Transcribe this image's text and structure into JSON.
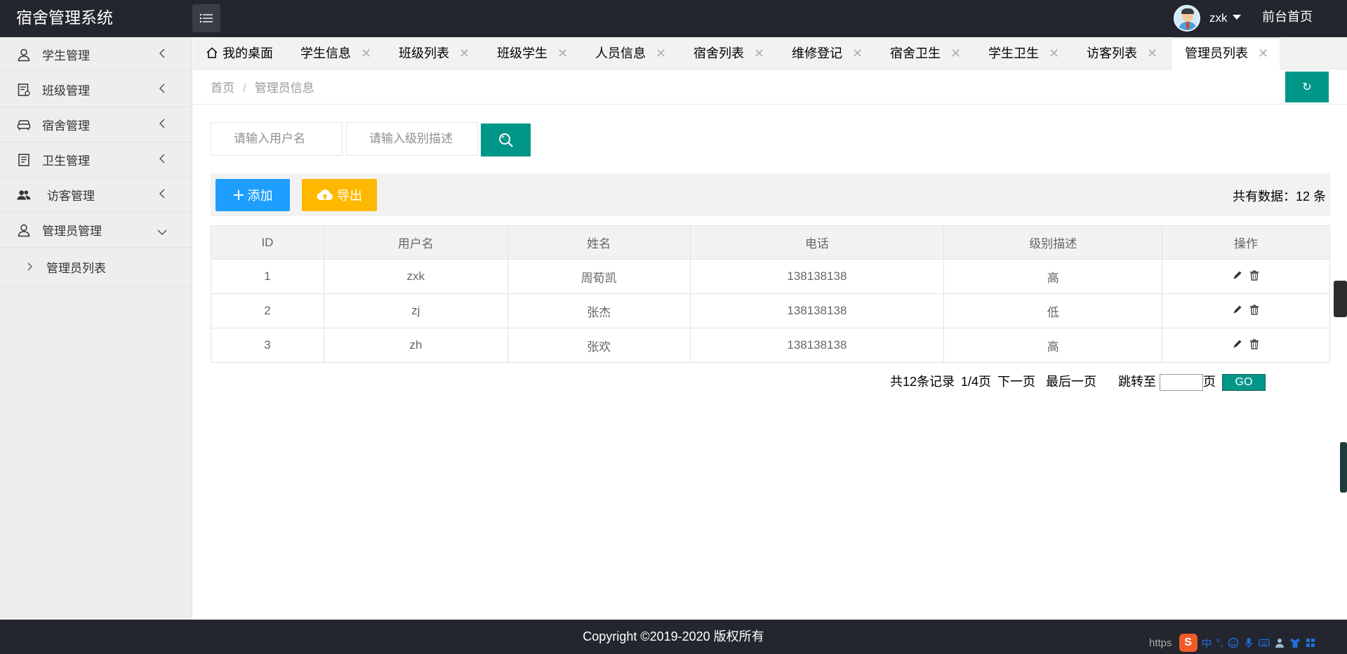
{
  "app": {
    "title": "宿舍管理系统",
    "username": "zxk",
    "front_link": "前台首页"
  },
  "sidebar": {
    "items": [
      {
        "label": "学生管理",
        "icon": "user-icon",
        "expanded": false
      },
      {
        "label": "班级管理",
        "icon": "class-icon",
        "expanded": false
      },
      {
        "label": "宿舍管理",
        "icon": "sofa-icon",
        "expanded": false
      },
      {
        "label": "卫生管理",
        "icon": "document-icon",
        "expanded": false
      },
      {
        "label": "访客管理",
        "icon": "users-icon",
        "expanded": false
      },
      {
        "label": "管理员管理",
        "icon": "admin-icon",
        "expanded": true
      }
    ],
    "sub_items": [
      {
        "label": "管理员列表"
      }
    ]
  },
  "tabs": [
    {
      "label": "我的桌面",
      "closable": false
    },
    {
      "label": "学生信息",
      "closable": true
    },
    {
      "label": "班级列表",
      "closable": true
    },
    {
      "label": "班级学生",
      "closable": true
    },
    {
      "label": "人员信息",
      "closable": true
    },
    {
      "label": "宿舍列表",
      "closable": true
    },
    {
      "label": "维修登记",
      "closable": true
    },
    {
      "label": "宿舍卫生",
      "closable": true
    },
    {
      "label": "学生卫生",
      "closable": true
    },
    {
      "label": "访客列表",
      "closable": true
    },
    {
      "label": "管理员列表",
      "closable": true,
      "active": true
    }
  ],
  "tab_close_glyph": "✕",
  "breadcrumb": {
    "home": "首页",
    "separator": "/",
    "current": "管理员信息"
  },
  "refresh_glyph": "↻",
  "search": {
    "username_placeholder": "请输入用户名",
    "level_placeholder": "请输入级别描述"
  },
  "toolbar": {
    "add_label": "添加",
    "export_label": "导出",
    "total_text": "共有数据：12 条"
  },
  "table": {
    "headers": [
      "ID",
      "用户名",
      "姓名",
      "电话",
      "级别描述",
      "操作"
    ],
    "rows": [
      {
        "id": "1",
        "username": "zxk",
        "name": "周荀凯",
        "phone": "138138138",
        "level": "高"
      },
      {
        "id": "2",
        "username": "zj",
        "name": "张杰",
        "phone": "138138138",
        "level": "低"
      },
      {
        "id": "3",
        "username": "zh",
        "name": "张欢",
        "phone": "138138138",
        "level": "高"
      }
    ]
  },
  "pager": {
    "records": "共12条记录",
    "page": "1/4页",
    "next": "下一页",
    "last": "最后一页",
    "jump_to": "跳转至",
    "page_unit": "页",
    "go": "GO"
  },
  "footer": {
    "copyright": "Copyright ©2019-2020 版权所有"
  },
  "ime": {
    "url_prefix": "https",
    "logo": "S",
    "lang": "中",
    "punct": "°,"
  },
  "colors": {
    "header_bg": "#23262e",
    "primary_teal": "#009688",
    "blue": "#1e9fff",
    "orange": "#ffb800"
  }
}
